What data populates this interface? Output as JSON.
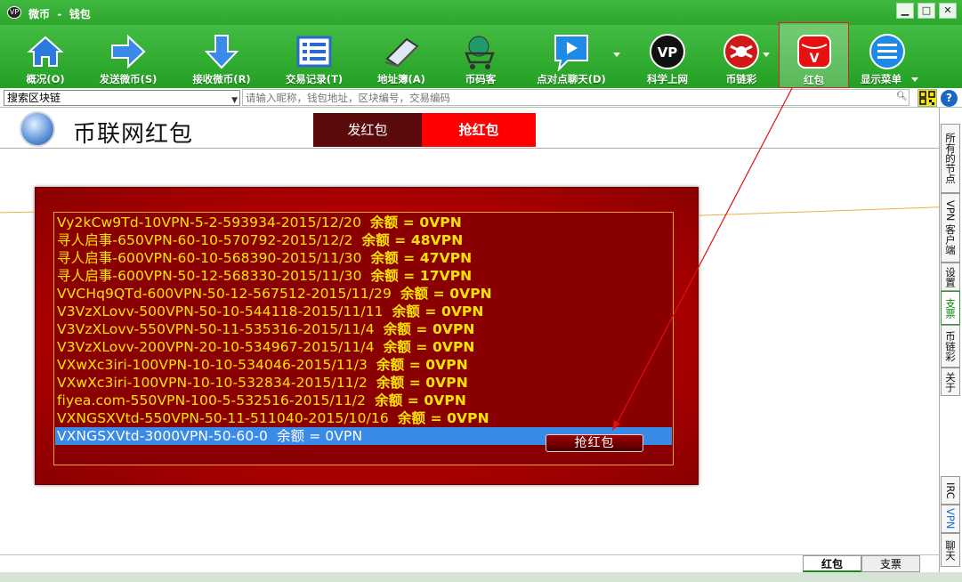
{
  "window": {
    "title": "微币  -  钱包",
    "logo": "VP",
    "controls": [
      "▁",
      "□",
      "✕"
    ]
  },
  "toolbar": {
    "items": [
      {
        "label": "概况(O)",
        "icon": "home-icon"
      },
      {
        "label": "发送微币(S)",
        "icon": "arrow-right-icon"
      },
      {
        "label": "接收微币(R)",
        "icon": "arrow-down-icon"
      },
      {
        "label": "交易记录(T)",
        "icon": "list-icon"
      },
      {
        "label": "地址簿(A)",
        "icon": "notebook-icon"
      },
      {
        "label": "币码客",
        "icon": "cart-icon"
      },
      {
        "label": "点对点聊天(D)",
        "icon": "chat-bubble-icon"
      },
      {
        "label": "科学上网",
        "icon": "vpn-globe-icon"
      },
      {
        "label": "币链彩",
        "icon": "lottery-icon"
      },
      {
        "label": "红包",
        "icon": "red-packet-icon"
      },
      {
        "label": "显示菜单",
        "icon": "menu-icon"
      }
    ]
  },
  "search": {
    "scope": "搜索区块链",
    "placeholder": "请输入昵称，钱包地址，区块编号，交易编码"
  },
  "redpacket": {
    "title": "币联网红包",
    "tab_send": "发红包",
    "tab_grab": "抢红包",
    "balance_label": "余额",
    "rows": [
      {
        "name": "Vy2kCw9Td-10VPN-5-2-593934-2015/12/20",
        "balance": "= 0VPN"
      },
      {
        "name": "寻人启事-650VPN-60-10-570792-2015/12/2",
        "balance": "= 48VPN"
      },
      {
        "name": "寻人启事-600VPN-60-10-568390-2015/11/30",
        "balance": "= 47VPN"
      },
      {
        "name": "寻人启事-600VPN-50-12-568330-2015/11/30",
        "balance": "= 17VPN"
      },
      {
        "name": "VVCHq9QTd-600VPN-50-12-567512-2015/11/29",
        "balance": "= 0VPN"
      },
      {
        "name": "V3VzXLovv-500VPN-50-10-544118-2015/11/11",
        "balance": "= 0VPN"
      },
      {
        "name": "V3VzXLovv-550VPN-50-11-535316-2015/11/4",
        "balance": "= 0VPN"
      },
      {
        "name": "V3VzXLovv-200VPN-20-10-534967-2015/11/4",
        "balance": "= 0VPN"
      },
      {
        "name": "VXwXc3iri-100VPN-10-10-534046-2015/11/3",
        "balance": "= 0VPN"
      },
      {
        "name": "VXwXc3iri-100VPN-10-10-532834-2015/11/2",
        "balance": "= 0VPN"
      },
      {
        "name": "fiyea.com-550VPN-100-5-532516-2015/11/2",
        "balance": "= 0VPN"
      },
      {
        "name": "VXNGSXVtd-550VPN-50-11-511040-2015/10/16",
        "balance": "= 0VPN"
      },
      {
        "name": "VXNGSXVtd-3000VPN-50-60-0",
        "balance": "= 0VPN"
      }
    ],
    "grab_button": "抢红包"
  },
  "sidebar_tabs": [
    "所有的节点",
    "VPN 客户端",
    "设置",
    "支票",
    "币链彩",
    "关于",
    "IRC",
    "VPN",
    "聊天"
  ],
  "bottom_tabs": [
    "红包",
    "支票"
  ],
  "colors": {
    "green": "#2ea62e",
    "red": "#ff0000",
    "gold": "#ffe400",
    "selection": "#3a8ae8"
  }
}
